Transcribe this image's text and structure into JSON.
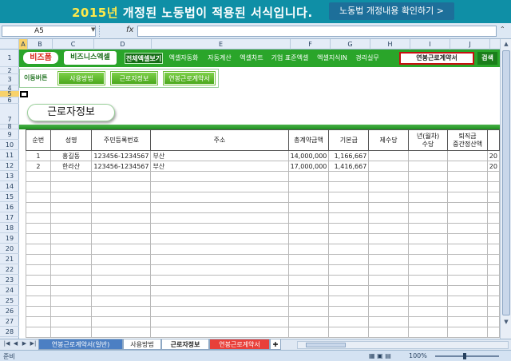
{
  "banner": {
    "year_text": "2015년",
    "title_rest": " 개정된 노동법이 적용된 서식입니다.",
    "link_label": "노동법 개정내용 확인하기 >"
  },
  "formula_bar": {
    "cell_ref": "A5",
    "fx_icon": "fx",
    "value": ""
  },
  "columns": [
    "A",
    "B",
    "C",
    "D",
    "E",
    "F",
    "G",
    "H",
    "I",
    "J"
  ],
  "rows": [
    "1",
    "2",
    "3",
    "4",
    "5",
    "6",
    "7",
    "8",
    "9",
    "10",
    "11",
    "12",
    "13",
    "14",
    "15",
    "16",
    "17",
    "18",
    "19",
    "20",
    "21",
    "22",
    "23",
    "24",
    "25",
    "26",
    "27",
    "28",
    "29"
  ],
  "menu": {
    "logo_brand": "비즈폼",
    "logo_product": "비즈니스엑셀",
    "items": [
      "전체엑셀보기",
      "엑셀자동화",
      "자동계산",
      "엑셀차트",
      "기업 표준엑셀",
      "엑셀지식IN",
      "경리실무"
    ],
    "contract_button": "연봉근로계약서",
    "search_button": "검색"
  },
  "action_bar": {
    "label": "이동버튼",
    "buttons": [
      "사용방법",
      "근로자정보",
      "연봉근로계약서"
    ]
  },
  "page_title": "근로자정보",
  "table": {
    "headers": [
      "순번",
      "성명",
      "주민등록번호",
      "주소",
      "총계약금액",
      "기본급",
      "제수당",
      "년(월차)\n수당",
      "퇴직금\n중간정산액",
      ""
    ],
    "rows": [
      [
        "1",
        "홍길동",
        "123456-1234567",
        "부산",
        "14,000,000",
        "1,166,667",
        "",
        "",
        "",
        "20"
      ],
      [
        "2",
        "한라산",
        "123456-1234567",
        "부산",
        "17,000,000",
        "1,416,667",
        "",
        "",
        "",
        "20"
      ]
    ],
    "empty_rows": 16
  },
  "sheet_tabs": {
    "tabs": [
      "연봉근로계약서(일반)",
      "사용방법",
      "근로자정보",
      "연봉근로계약서"
    ],
    "active": "근로자정보"
  },
  "status": {
    "text": "준비",
    "zoom": "100%"
  },
  "colors": {
    "banner": "#0f8fa6",
    "banner_accent": "#ffe94a",
    "menu_green": "#2aa52a",
    "contract_border": "#c61010"
  }
}
